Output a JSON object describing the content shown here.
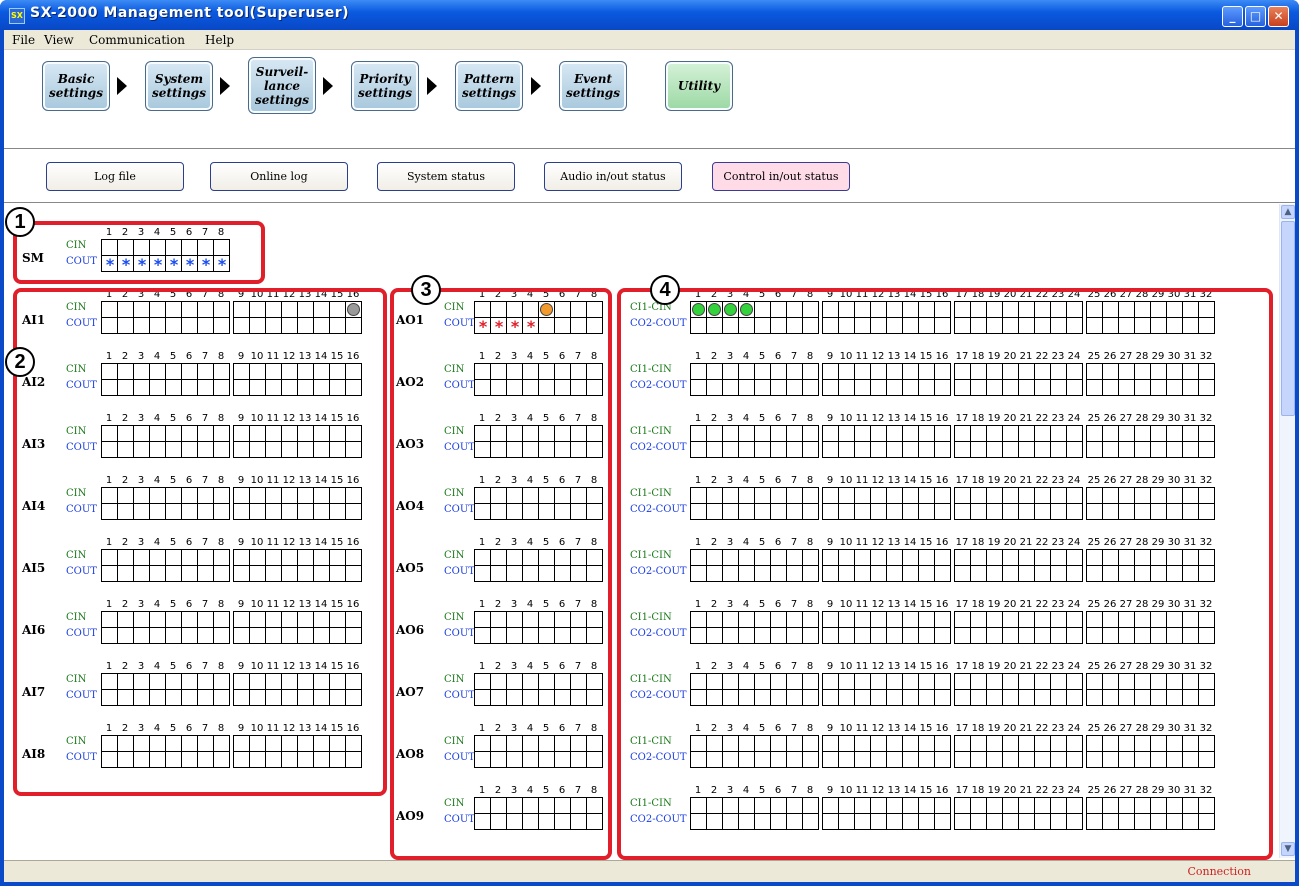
{
  "window": {
    "title": "SX-2000 Management tool(Superuser)",
    "app_icon": "SX"
  },
  "menu": [
    "File",
    "View",
    "Communication",
    "Help"
  ],
  "steps": [
    "Basic settings",
    "System settings",
    "Surveil-lance settings",
    "Priority settings",
    "Pattern settings",
    "Event settings",
    "Utility"
  ],
  "utility_tabs": [
    "Log file",
    "Online log",
    "System status",
    "Audio in/out status",
    "Control in/out status"
  ],
  "active_tab": "Control in/out status",
  "labels": {
    "cin": "CIN",
    "cout": "COUT",
    "ci1_cin": "CI1-CIN",
    "co2_cout": "CO2-COUT"
  },
  "sm": {
    "name": "SM",
    "cout_stars": [
      1,
      2,
      3,
      4,
      5,
      6,
      7,
      8
    ]
  },
  "ai_units": [
    "AI1",
    "AI2",
    "AI3",
    "AI4",
    "AI5",
    "AI6",
    "AI7",
    "AI8"
  ],
  "ao_units": [
    "AO1",
    "AO2",
    "AO3",
    "AO4",
    "AO5",
    "AO6",
    "AO7",
    "AO8",
    "AO9"
  ],
  "ci_units_count": 9,
  "states": {
    "ai1_cin_active": [
      16
    ],
    "ao1_cin_active": [
      5
    ],
    "ao1_cout_stars": [
      1,
      2,
      3,
      4
    ],
    "ci1_cin_active": [
      1,
      2,
      3,
      4
    ]
  },
  "colors": {
    "sm_star": "#1a4cf0",
    "ao_star": "#e01f2a",
    "ai_dot": "#9a9a9a",
    "ao_dot": "#f29a2e",
    "ci_dot": "#34d23c",
    "callout": "#e01f2a"
  },
  "callouts": [
    "1",
    "2",
    "3",
    "4"
  ],
  "status": {
    "connection": "Connection"
  }
}
